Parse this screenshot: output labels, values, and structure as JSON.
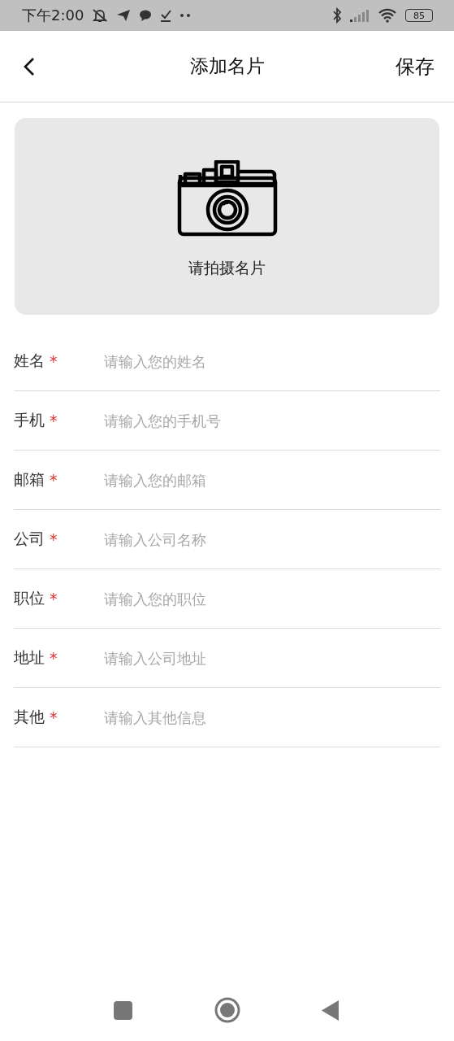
{
  "status_bar": {
    "time": "下午2:00",
    "battery": "85"
  },
  "header": {
    "title": "添加名片",
    "action": "保存"
  },
  "photo_card": {
    "caption": "请拍摄名片"
  },
  "fields": [
    {
      "label": "姓名",
      "required_mark": "*",
      "placeholder": "请输入您的姓名"
    },
    {
      "label": "手机",
      "required_mark": "*",
      "placeholder": "请输入您的手机号"
    },
    {
      "label": "邮箱",
      "required_mark": "*",
      "placeholder": "请输入您的邮箱"
    },
    {
      "label": "公司",
      "required_mark": "*",
      "placeholder": "请输入公司名称"
    },
    {
      "label": "职位",
      "required_mark": "*",
      "placeholder": "请输入您的职位"
    },
    {
      "label": "地址",
      "required_mark": "*",
      "placeholder": "请输入公司地址"
    },
    {
      "label": "其他",
      "required_mark": "*",
      "placeholder": "请输入其他信息"
    }
  ]
}
